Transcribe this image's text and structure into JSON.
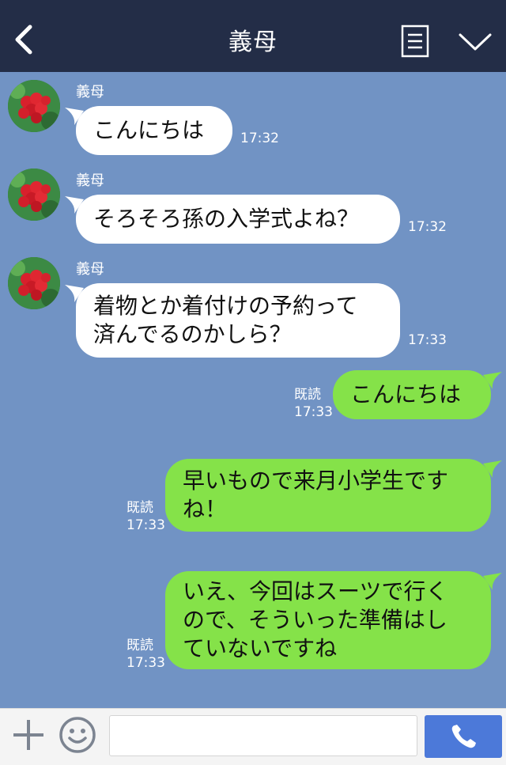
{
  "header": {
    "title": "義母",
    "back_icon": "chevron-left-icon",
    "menu_icon": "notes-icon",
    "dropdown_icon": "chevron-down-icon"
  },
  "colors": {
    "header_bg": "#232d47",
    "chat_bg": "#7193c4",
    "incoming_bubble": "#ffffff",
    "outgoing_bubble": "#85e249",
    "send_button": "#4c79d9"
  },
  "messages": [
    {
      "direction": "in",
      "sender": "義母",
      "text": "こんにちは",
      "time": "17:32"
    },
    {
      "direction": "in",
      "sender": "義母",
      "text": "そろそろ孫の入学式よね？",
      "time": "17:32"
    },
    {
      "direction": "in",
      "sender": "義母",
      "text": "着物とか着付けの予約って\n済んでるのかしら？",
      "time": "17:33"
    },
    {
      "direction": "out",
      "read": "既読",
      "text": "こんにちは",
      "time": "17:33"
    },
    {
      "direction": "out",
      "read": "既読",
      "text": "早いもので来月小学生です\nね！",
      "time": "17:33"
    },
    {
      "direction": "out",
      "read": "既読",
      "text": "いえ、今回はスーツで行く\nので、そういった準備はし\nていないですね",
      "time": "17:33"
    }
  ],
  "footer": {
    "add_icon": "plus-icon",
    "sticker_icon": "smiley-icon",
    "message_value": "",
    "call_icon": "phone-icon"
  }
}
